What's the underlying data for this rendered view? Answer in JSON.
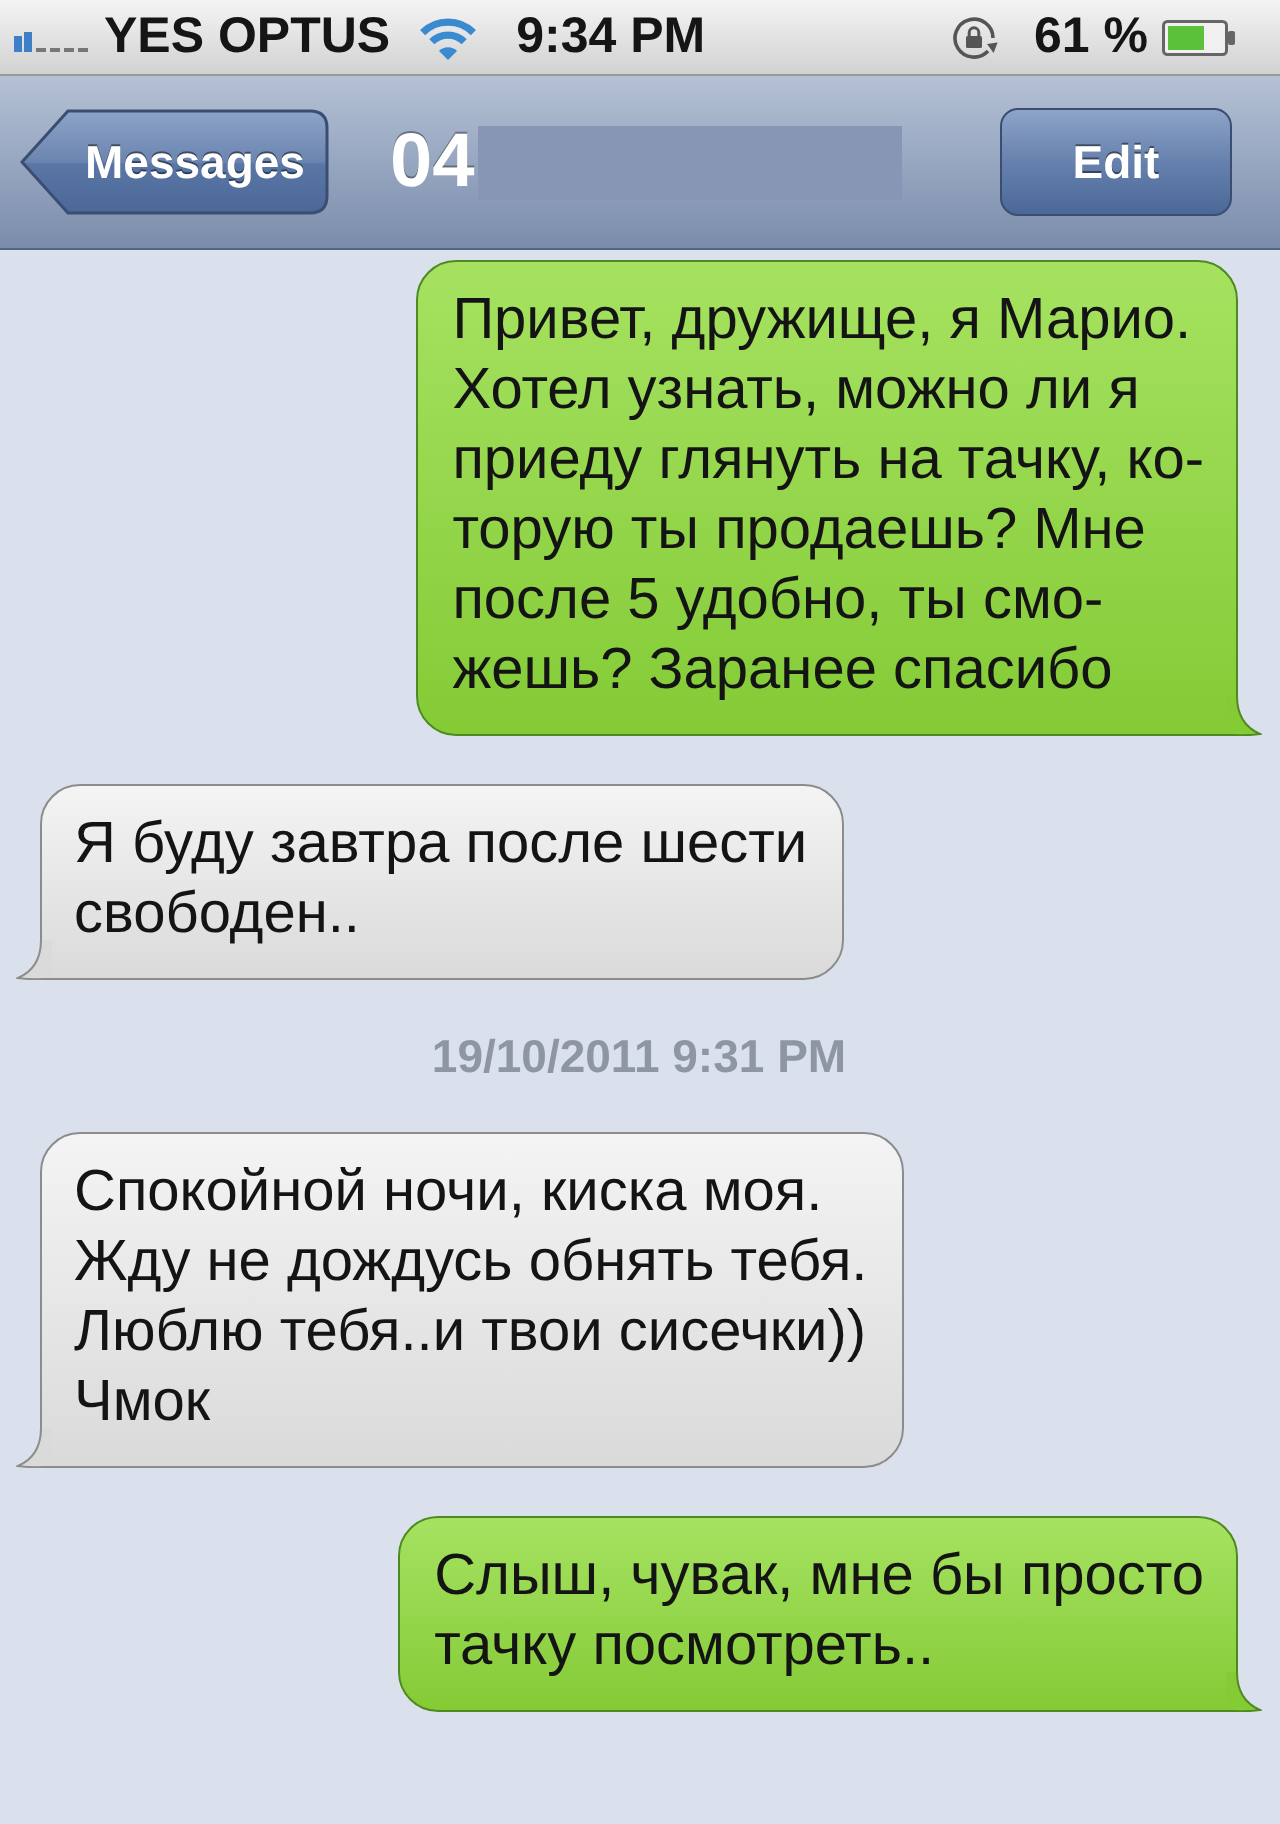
{
  "status_bar": {
    "carrier": "YES OPTUS",
    "time": "9:34 PM",
    "battery_percent": "61 %"
  },
  "nav_bar": {
    "back_button": "Messages",
    "title": "04",
    "edit_button": "Edit"
  },
  "messages": [
    {
      "kind": "sent",
      "lines": [
        "Привет, дружище, я Марио.",
        "Хотел узнать, можно ли я",
        "приеду глянуть на тачку, ко-",
        "торую ты продаешь? Мне",
        "после 5 удобно, ты смо-",
        "жешь? Заранее спасибо"
      ]
    },
    {
      "kind": "received",
      "lines": [
        "Я буду завтра после шести",
        "свободен.."
      ]
    },
    {
      "kind": "timestamp",
      "text": "19/10/2011 9:31 PM"
    },
    {
      "kind": "received",
      "lines": [
        "Спокойной ночи, киска моя.",
        "Жду не дождусь обнять тебя.",
        "Люблю тебя..и твои сисечки))",
        "Чмок"
      ]
    },
    {
      "kind": "sent",
      "lines": [
        "Слыш, чувак, мне бы просто",
        "тачку посмотреть.."
      ]
    }
  ]
}
